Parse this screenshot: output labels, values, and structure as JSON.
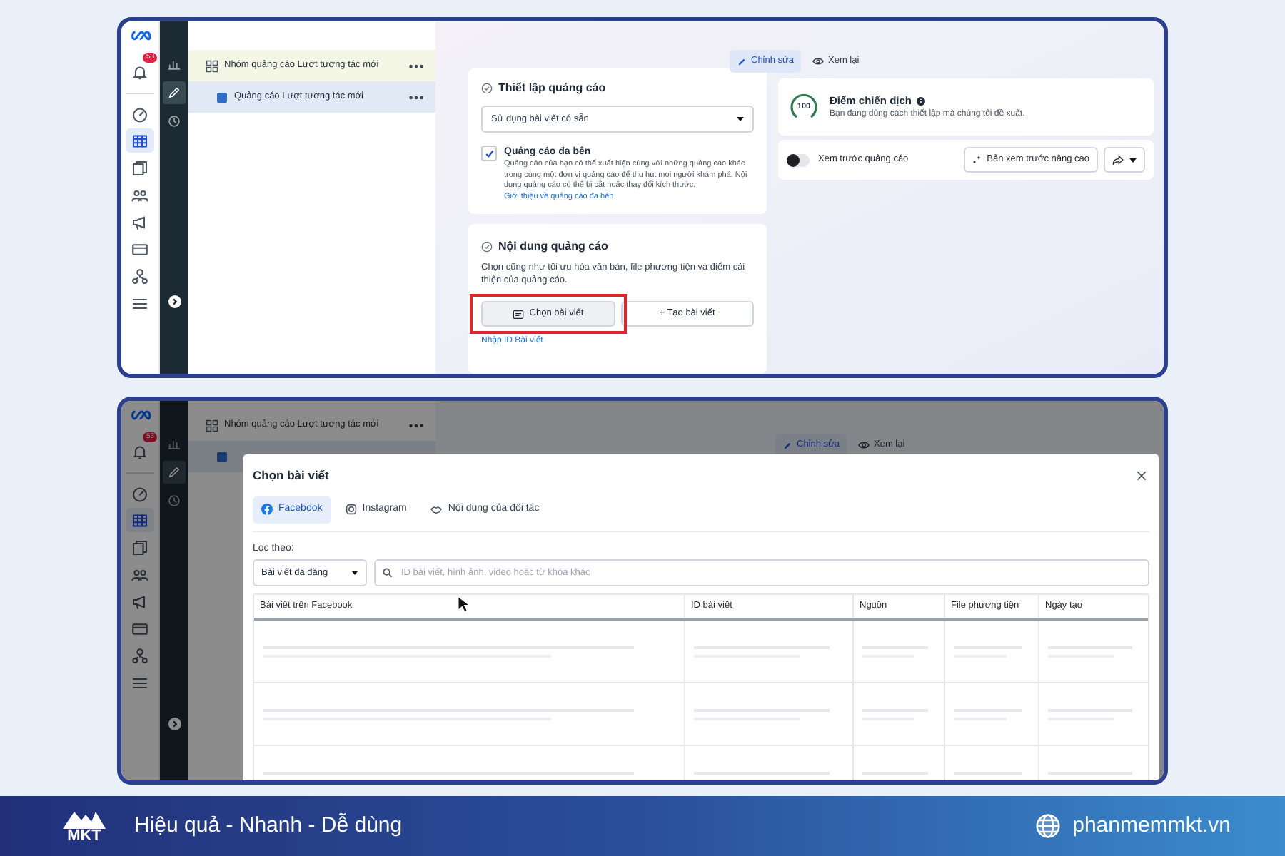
{
  "top_screen": {
    "notification_count": "53",
    "rail": [
      {
        "kind": "gauge",
        "selected": false
      },
      {
        "kind": "table",
        "selected": true
      },
      {
        "kind": "pages",
        "selected": false
      },
      {
        "kind": "people",
        "selected": false
      },
      {
        "kind": "megaphone",
        "selected": false
      },
      {
        "kind": "card",
        "selected": false
      },
      {
        "kind": "network",
        "selected": false
      },
      {
        "kind": "menu",
        "selected": false
      }
    ],
    "tools": [
      {
        "kind": "chart",
        "selected": false
      },
      {
        "kind": "pencil",
        "selected": true
      },
      {
        "kind": "clock",
        "selected": false
      }
    ],
    "tree": [
      {
        "kind": "ad_set",
        "label": "Nhóm quảng cáo Lượt tương tác mới",
        "selected": false,
        "children": [
          {
            "kind": "ad",
            "label": "Quảng cáo Lượt tương tác mới",
            "selected": true
          }
        ]
      }
    ],
    "view_tabs": [
      {
        "label": "Chỉnh sửa",
        "selected": true
      },
      {
        "label": "Xem lại",
        "selected": false
      }
    ],
    "ad_setup": {
      "title": "Thiết lập quảng cáo",
      "select_value": "Sử dụng bài viết có sẵn",
      "option": {
        "label": "Quảng cáo đa bên",
        "checked": true,
        "description": "Quảng cáo của bạn có thể xuất hiện cùng với những quảng cáo khác trong cùng một đơn vị quảng cáo để thu hút mọi người khám phá. Nội dung quảng cáo có thể bị cắt hoặc thay đổi kích thước.",
        "link": "Giới thiệu về quảng cáo đa bên"
      }
    },
    "ad_content": {
      "title": "Nội dung quảng cáo",
      "description": "Chọn cũng như tối ưu hóa văn bản, file phương tiện và điểm cải thiện của quảng cáo.",
      "buttons": [
        {
          "kind": "select",
          "label": "Chọn bài viết",
          "highlighted": true
        },
        {
          "kind": "create",
          "label": "+ Tạo bài viết",
          "highlighted": false
        }
      ],
      "link": "Nhập ID Bài viết"
    },
    "score": {
      "value": "100",
      "title": "Điểm chiến dịch",
      "subtitle": "Bạn đang dùng cách thiết lập mà chúng tôi đề xuất."
    },
    "preview": {
      "label": "Xem trước quảng cáo",
      "on": false,
      "advanced_button": "Bản xem trước nâng cao"
    }
  },
  "bottom_screen": {
    "notification_count": "53",
    "rail": [
      {
        "kind": "gauge",
        "selected": false
      },
      {
        "kind": "table",
        "selected": true
      },
      {
        "kind": "pages",
        "selected": false
      },
      {
        "kind": "people",
        "selected": false
      },
      {
        "kind": "megaphone",
        "selected": false
      },
      {
        "kind": "card",
        "selected": false
      },
      {
        "kind": "network",
        "selected": false
      },
      {
        "kind": "menu",
        "selected": false
      }
    ],
    "tools": [
      {
        "kind": "chart",
        "selected": false
      },
      {
        "kind": "pencil",
        "selected": true
      },
      {
        "kind": "clock",
        "selected": false
      }
    ],
    "tree_row": "Nhóm quảng cáo Lượt tương tác mới",
    "view_tabs": [
      {
        "label": "Chỉnh sửa",
        "selected": true
      },
      {
        "label": "Xem lại",
        "selected": false
      }
    ],
    "modal": {
      "title": "Chọn bài viết",
      "tabs": [
        {
          "kind": "facebook",
          "label": "Facebook",
          "selected": true
        },
        {
          "kind": "instagram",
          "label": "Instagram",
          "selected": false
        },
        {
          "kind": "partner",
          "label": "Nội dung của đối tác",
          "selected": false
        }
      ],
      "filter_label": "Lọc theo:",
      "filter_value": "Bài viết đã đăng",
      "search_placeholder": "ID bài viết, hình ảnh, video hoặc từ khóa khác",
      "columns": [
        "Bài viết trên Facebook",
        "ID bài viết",
        "Nguồn",
        "File phương tiện",
        "Ngày tạo"
      ],
      "loading": true
    }
  },
  "footer": {
    "logo": "MKT",
    "slogan": "Hiệu quả - Nhanh - Dễ dùng",
    "website": "phanmemmkt.vn"
  }
}
